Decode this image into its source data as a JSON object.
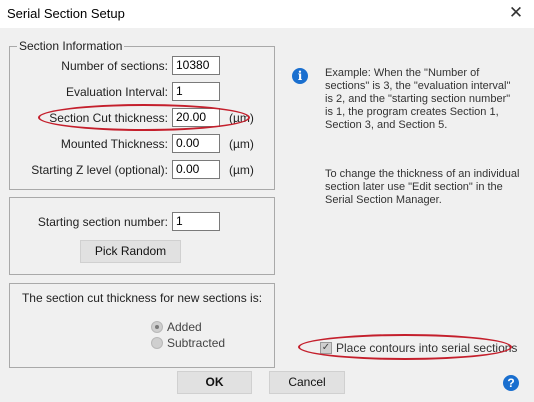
{
  "window": {
    "title": "Serial Section Setup",
    "close_glyph": "✕"
  },
  "section_info": {
    "legend": "Section Information",
    "fields": [
      {
        "label": "Number of sections:",
        "value": "10380",
        "unit": ""
      },
      {
        "label": "Evaluation Interval:",
        "value": "1",
        "unit": ""
      },
      {
        "label": "Section Cut thickness:",
        "value": "20.00",
        "unit": "(µm)"
      },
      {
        "label": "Mounted Thickness:",
        "value": "0.00",
        "unit": "(µm)"
      },
      {
        "label": "Starting Z level (optional):",
        "value": "0.00",
        "unit": "(µm)"
      }
    ]
  },
  "starting_section": {
    "label": "Starting section number:",
    "value": "1",
    "pick_random_label": "Pick Random"
  },
  "thickness_mode": {
    "label": "The section cut thickness for new sections is:",
    "options": [
      {
        "label": "Added",
        "selected": true
      },
      {
        "label": "Subtracted",
        "selected": false
      }
    ]
  },
  "info": {
    "icon": "info-icon",
    "example_text": "Example: When the \"Number of sections\" is 3, the \"evaluation interval\" is 2, and the \"starting section number\" is 1, the program creates Section 1, Section 3, and Section 5.",
    "change_text": "To change the thickness of an individual section later use \"Edit section\" in the Serial Section Manager."
  },
  "place_contours": {
    "label": "Place contours into serial sections",
    "checked": true
  },
  "buttons": {
    "ok": "OK",
    "cancel": "Cancel"
  },
  "help": {
    "glyph": "?"
  },
  "colors": {
    "highlight": "#c41f2c",
    "info_blue": "#1a6fcf"
  }
}
